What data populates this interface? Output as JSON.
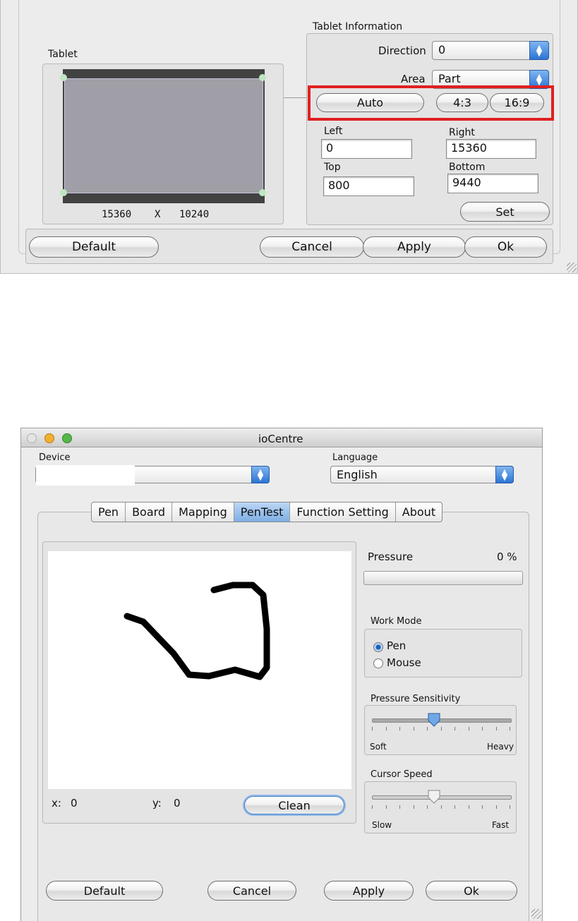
{
  "top_window": {
    "tablet_group": {
      "label": "Tablet",
      "dimensions": {
        "width": "15360",
        "x_sep": "X",
        "height": "10240"
      }
    },
    "tablet_info": {
      "label": "Tablet Information",
      "direction_label": "Direction",
      "direction_value": "0",
      "area_label": "Area",
      "area_value": "Part",
      "auto_button": "Auto",
      "ratio_4_3_button": "4:3",
      "ratio_16_9_button": "16:9",
      "highlight_color": "#e02020",
      "left_label": "Left",
      "left_value": "0",
      "right_label": "Right",
      "right_value": "15360",
      "top_label": "Top",
      "top_value": "800",
      "bottom_label": "Bottom",
      "bottom_value": "9440",
      "set_button": "Set"
    },
    "buttons": {
      "default": "Default",
      "cancel": "Cancel",
      "apply": "Apply",
      "ok": "Ok"
    }
  },
  "bottom_window": {
    "title": "ioCentre",
    "device_label": "Device",
    "device_value": "",
    "language_label": "Language",
    "language_value": "English",
    "tabs": [
      "Pen",
      "Board",
      "Mapping",
      "PenTest",
      "Function Setting",
      "About"
    ],
    "active_tab": "PenTest",
    "pentest": {
      "x_label": "x:",
      "x_value": "0",
      "y_label": "y:",
      "y_value": "0",
      "clean_button": "Clean"
    },
    "pressure": {
      "label": "Pressure",
      "value": "0 %",
      "level": 0
    },
    "work_mode": {
      "label": "Work Mode",
      "options": [
        "Pen",
        "Mouse"
      ],
      "selected": "Pen"
    },
    "pressure_sensitivity": {
      "label": "Pressure Sensitivity",
      "min_label": "Soft",
      "max_label": "Heavy",
      "level": 0.45
    },
    "cursor_speed": {
      "label": "Cursor Speed",
      "min_label": "Slow",
      "max_label": "Fast",
      "level": 0.45
    },
    "buttons": {
      "default": "Default",
      "cancel": "Cancel",
      "apply": "Apply",
      "ok": "Ok"
    },
    "traffic_lights": {
      "close": "#e85b4c",
      "minimize": "#f0b030",
      "zoom": "#57b649"
    }
  }
}
